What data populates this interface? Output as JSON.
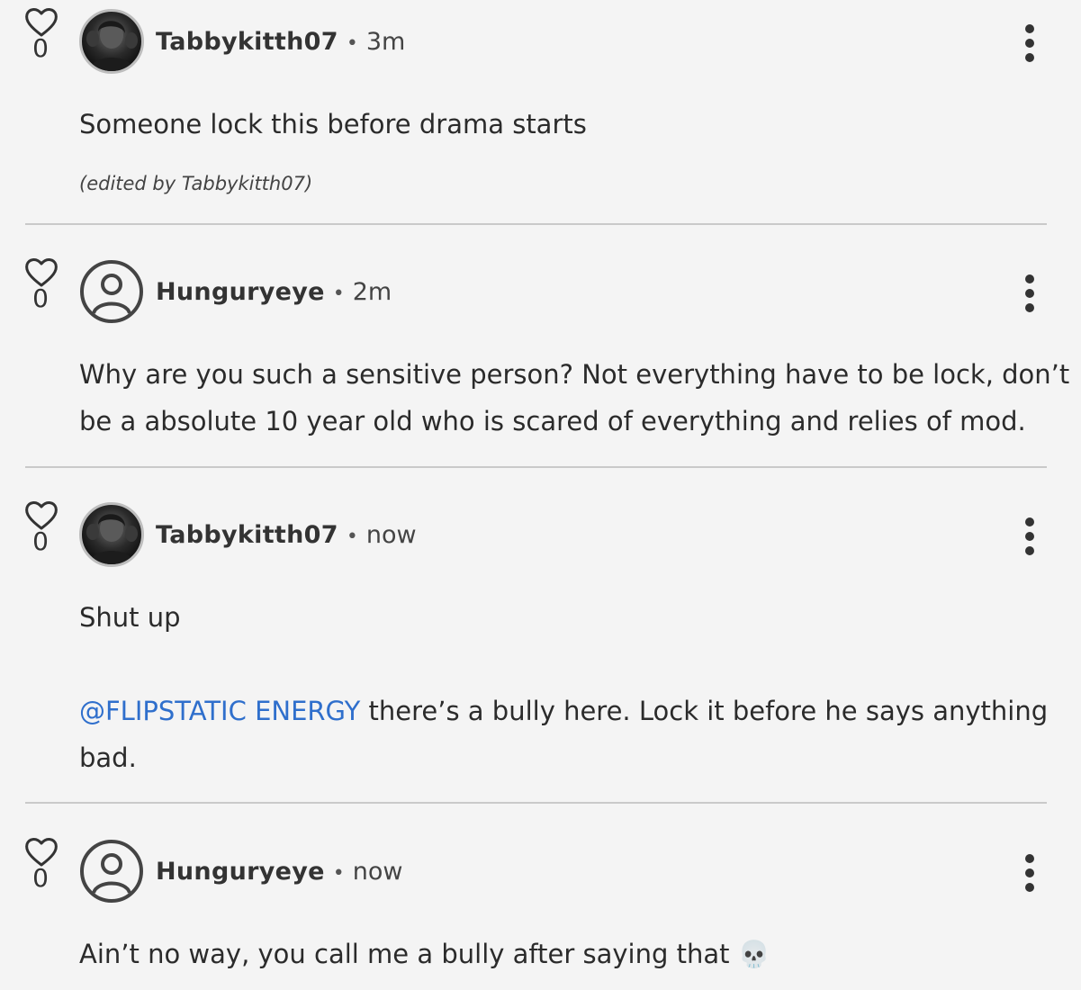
{
  "comments": [
    {
      "likes": "0",
      "username": "Tabbykitth07",
      "separator": "•",
      "time": "3m",
      "text": "Someone lock this before drama starts",
      "edited_note": "(edited by Tabbykitth07)"
    },
    {
      "likes": "0",
      "username": "Hunguryeye",
      "separator": "•",
      "time": "2m",
      "text_line1": "Why are you such a sensitive person? Not everything have to be lock, don’t",
      "text_line2": "be a absolute 10 year old who is scared of everything and relies of mod."
    },
    {
      "likes": "0",
      "username": "Tabbykitth07",
      "separator": "•",
      "time": "now",
      "text": "Shut up",
      "mention": "@FLIPSTATIC ENERGY",
      "text_after_mention": " there’s a bully here. Lock it before he says anything",
      "text_line_end": "bad."
    },
    {
      "likes": "0",
      "username": "Hunguryeye",
      "separator": "•",
      "time": "now",
      "text": "Ain’t no way, you call me a bully after saying that",
      "emoji": "💀"
    }
  ],
  "colors": {
    "background": "#f4f4f4",
    "mention": "#2f6fcc",
    "divider": "#c9c9c9",
    "text": "#2b2b2b"
  },
  "icons": {
    "like": "heart-outline-icon",
    "menu": "vertical-dots-icon",
    "default_avatar": "default-user-icon"
  }
}
